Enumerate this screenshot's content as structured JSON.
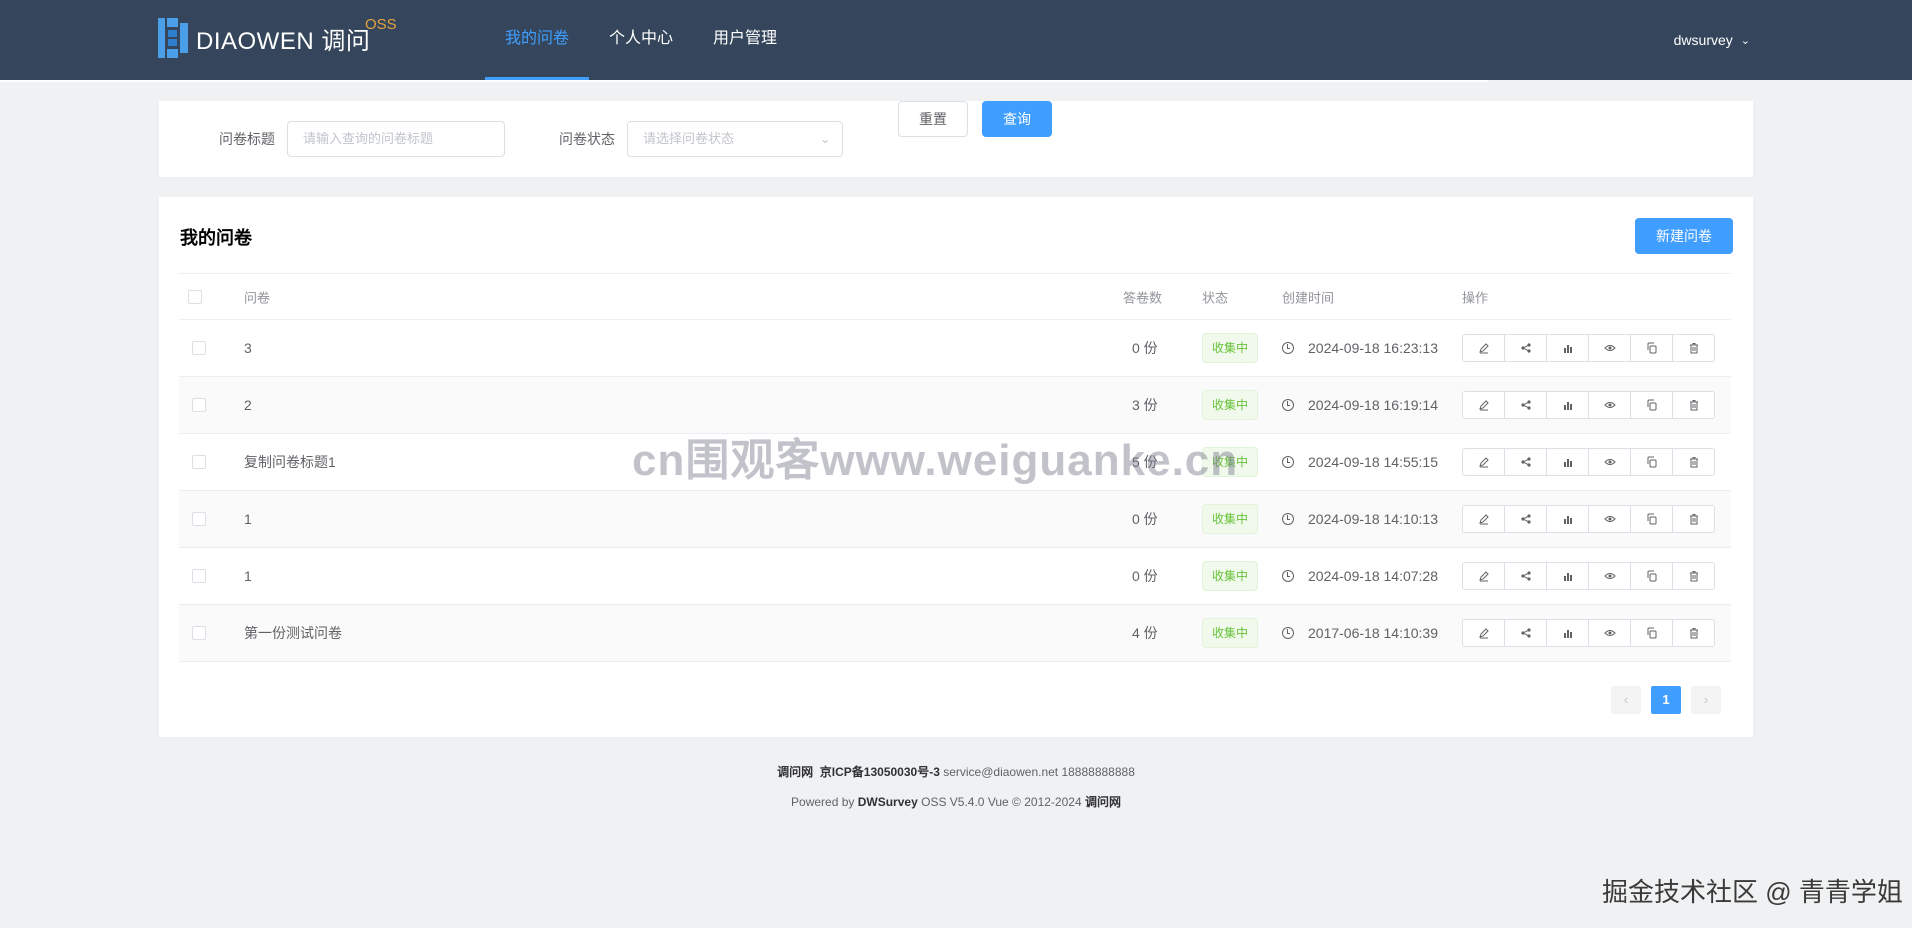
{
  "header": {
    "brand": "DIAOWEN 调问",
    "brand_sup": "OSS",
    "nav": [
      {
        "label": "我的问卷",
        "active": true
      },
      {
        "label": "个人中心",
        "active": false
      },
      {
        "label": "用户管理",
        "active": false
      }
    ],
    "user": "dwsurvey"
  },
  "search": {
    "title_label": "问卷标题",
    "title_placeholder": "请输入查询的问卷标题",
    "status_label": "问卷状态",
    "status_placeholder": "请选择问卷状态",
    "reset_label": "重置",
    "query_label": "查询"
  },
  "list": {
    "title": "我的问卷",
    "new_button": "新建问卷",
    "columns": {
      "name": "问卷",
      "answers": "答卷数",
      "status": "状态",
      "created": "创建时间",
      "actions": "操作"
    },
    "rows": [
      {
        "name": "3",
        "answers": "0 份",
        "status": "收集中",
        "created": "2024-09-18 16:23:13"
      },
      {
        "name": "2",
        "answers": "3 份",
        "status": "收集中",
        "created": "2024-09-18 16:19:14"
      },
      {
        "name": "复制问卷标题1",
        "answers": "5 份",
        "status": "收集中",
        "created": "2024-09-18 14:55:15"
      },
      {
        "name": "1",
        "answers": "0 份",
        "status": "收集中",
        "created": "2024-09-18 14:10:13"
      },
      {
        "name": "1",
        "answers": "0 份",
        "status": "收集中",
        "created": "2024-09-18 14:07:28"
      },
      {
        "name": "第一份测试问卷",
        "answers": "4 份",
        "status": "收集中",
        "created": "2017-06-18 14:10:39"
      }
    ],
    "action_icons": [
      "edit-icon",
      "share-icon",
      "chart-icon",
      "eye-icon",
      "copy-icon",
      "delete-icon"
    ],
    "pagination": {
      "prev": "‹",
      "current": "1",
      "next": "›"
    }
  },
  "footer": {
    "site": "调问网",
    "icp": "京ICP备13050030号-3",
    "contact": "service@diaowen.net 18888888888",
    "powered_prefix": "Powered by",
    "product": "DWSurvey",
    "version": "OSS V5.4.0 Vue © 2012-2024",
    "owner": "调问网"
  },
  "watermarks": {
    "center": "cn围观客www.weiguanke.cn",
    "corner": "掘金技术社区 @ 青青学姐"
  },
  "colors": {
    "topbar": "#35465c",
    "primary": "#409eff",
    "success": "#67c23a",
    "brand_sup": "#e6a23c"
  }
}
